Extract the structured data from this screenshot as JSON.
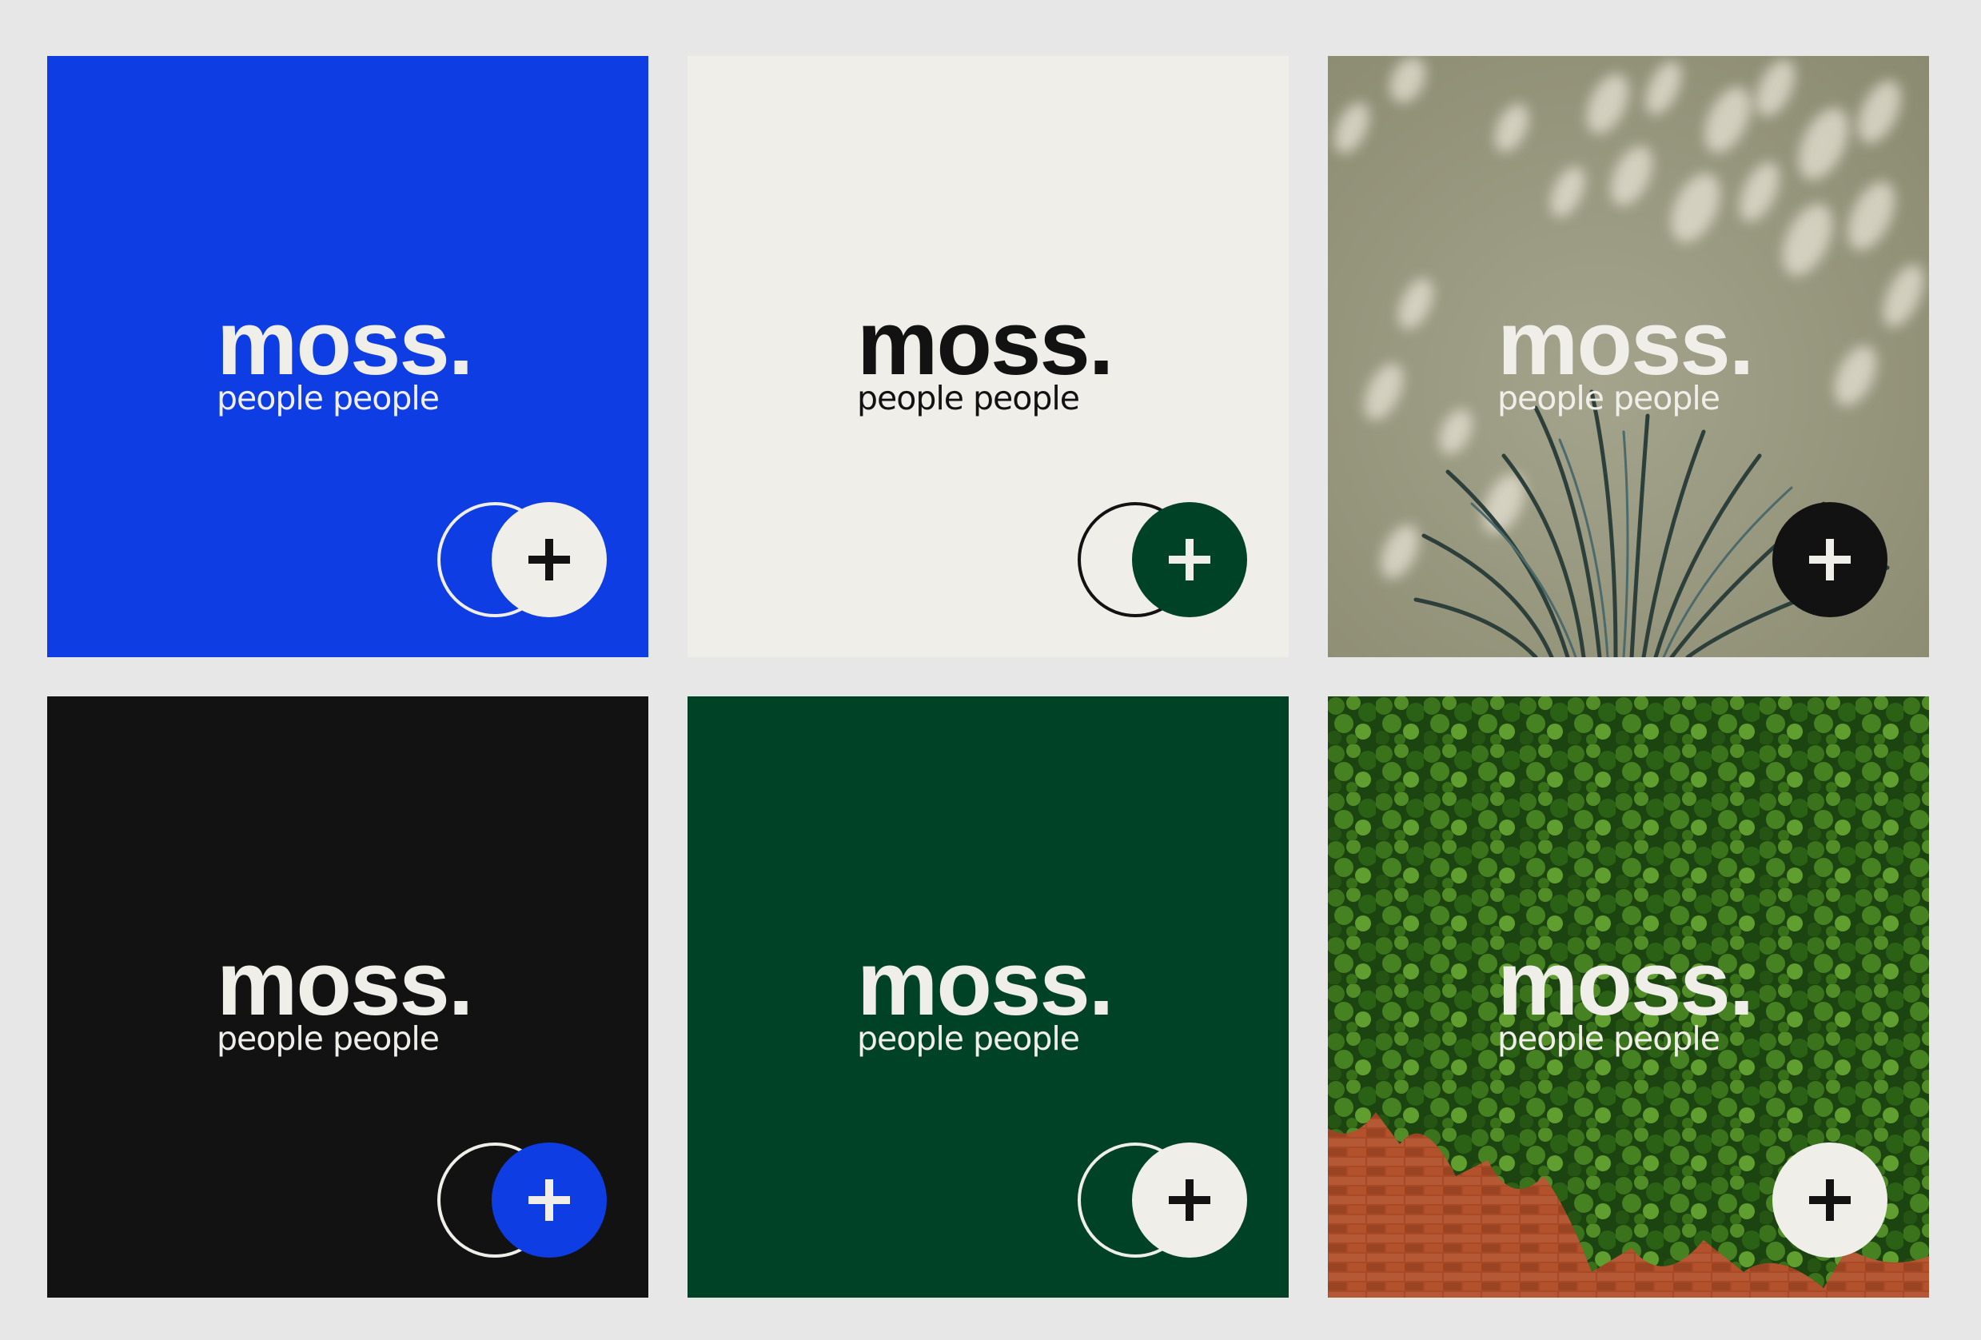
{
  "brand": {
    "wordmark": "moss.",
    "tagline": "people people"
  },
  "tiles": [
    {
      "id": "blue",
      "background": "#0d3de3",
      "text_color": "#f0eee9",
      "ring_color": "#f0eee9",
      "button_color": "#f0eee9",
      "plus_color": "#121212",
      "icon": "plus-icon"
    },
    {
      "id": "cream",
      "background": "#f0eee9",
      "text_color": "#121212",
      "ring_color": "#121212",
      "button_color": "#004225",
      "plus_color": "#f0eee9",
      "icon": "plus-icon"
    },
    {
      "id": "wall-photo",
      "background": "photo-concrete-wall-shadows",
      "text_color": "#f0eee9",
      "button_color": "#121212",
      "plus_color": "#f0eee9",
      "icon": "plus-icon"
    },
    {
      "id": "black",
      "background": "#121212",
      "text_color": "#f0eee9",
      "ring_color": "#f0eee9",
      "button_color": "#0d3de3",
      "plus_color": "#f0eee9",
      "icon": "plus-icon"
    },
    {
      "id": "green",
      "background": "#004225",
      "text_color": "#f0eee9",
      "ring_color": "#f0eee9",
      "button_color": "#f0eee9",
      "plus_color": "#121212",
      "icon": "plus-icon"
    },
    {
      "id": "ivy-photo",
      "background": "photo-ivy-brick-wall",
      "text_color": "#f0eee9",
      "button_color": "#f0eee9",
      "plus_color": "#121212",
      "icon": "plus-icon"
    }
  ]
}
